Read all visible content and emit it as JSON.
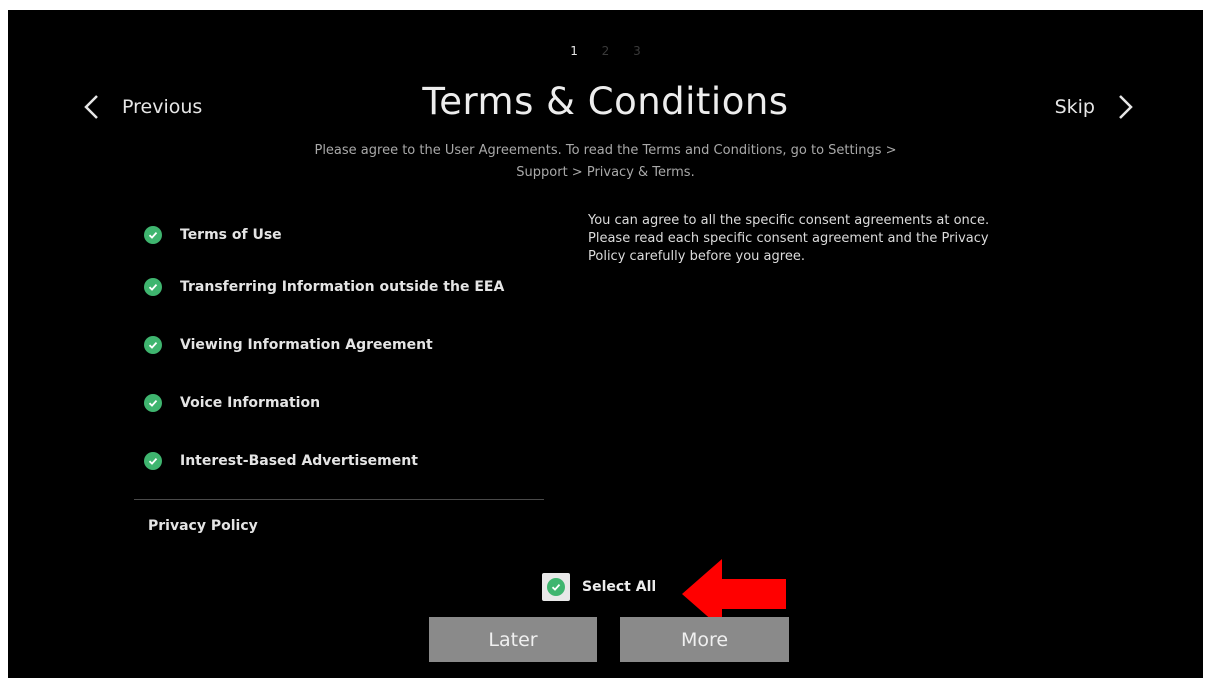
{
  "steps": [
    "1",
    "2",
    "3"
  ],
  "active_step": "1",
  "nav": {
    "previous_label": "Previous",
    "skip_label": "Skip"
  },
  "title": "Terms & Conditions",
  "subtitle_line1": "Please agree to the User Agreements. To read the Terms and Conditions, go to Settings >",
  "subtitle_line2": "Support > Privacy & Terms.",
  "agreements": [
    {
      "label": "Terms of Use",
      "checked": true
    },
    {
      "label": "Transferring Information outside the EEA",
      "checked": true
    },
    {
      "label": "Viewing Information Agreement",
      "checked": true
    },
    {
      "label": "Voice Information",
      "checked": true
    },
    {
      "label": "Interest-Based Advertisement",
      "checked": true
    }
  ],
  "privacy_policy_label": "Privacy Policy",
  "note": {
    "line1": "You can agree to all the specific consent agreements at once.",
    "line2": "Please read each specific consent agreement and the Privacy",
    "line3": "Policy carefully before you agree."
  },
  "select_all": {
    "label": "Select All",
    "checked": true
  },
  "buttons": {
    "later": "Later",
    "more": "More"
  },
  "colors": {
    "background": "#000000",
    "check_green": "#3fb56f",
    "button_gray": "#8a8a8a",
    "annotation_arrow": "#ff0000"
  },
  "icons": {
    "previous": "chevron-left-icon",
    "skip": "chevron-right-icon",
    "check": "check-circle-icon",
    "annotation": "red-arrow-icon"
  }
}
